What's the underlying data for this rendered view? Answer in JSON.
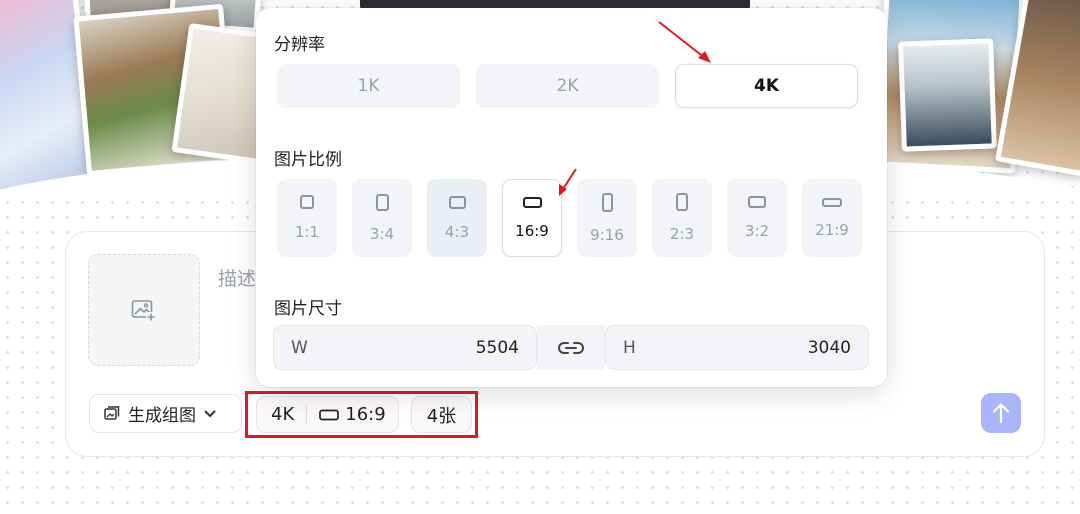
{
  "composer": {
    "prompt_placeholder": "描述",
    "mode_label": "生成组图",
    "resolution_chip": "4K",
    "ratio_chip": "16:9",
    "count_chip": "4张"
  },
  "popover": {
    "resolution": {
      "title": "分辨率",
      "options": [
        {
          "label": "1K",
          "selected": false
        },
        {
          "label": "2K",
          "selected": false
        },
        {
          "label": "4K",
          "selected": true
        }
      ]
    },
    "aspect_ratio": {
      "title": "图片比例",
      "options": [
        {
          "label": "1:1",
          "selected": false
        },
        {
          "label": "3:4",
          "selected": false
        },
        {
          "label": "4:3",
          "selected": false
        },
        {
          "label": "16:9",
          "selected": true
        },
        {
          "label": "9:16",
          "selected": false
        },
        {
          "label": "2:3",
          "selected": false
        },
        {
          "label": "3:2",
          "selected": false
        },
        {
          "label": "21:9",
          "selected": false
        }
      ]
    },
    "size": {
      "title": "图片尺寸",
      "width_label": "W",
      "width_value": "5504",
      "height_label": "H",
      "height_value": "3040"
    }
  },
  "colors": {
    "annotation_red": "#e0191f",
    "send_button": "#a9b4fb",
    "dot_pattern": "#bfe8ea"
  },
  "icons": {
    "upload": "image-plus-icon",
    "mode": "image-stack-icon",
    "dropdown": "chevron-down-icon",
    "link": "link-icon",
    "send": "arrow-up-icon"
  }
}
